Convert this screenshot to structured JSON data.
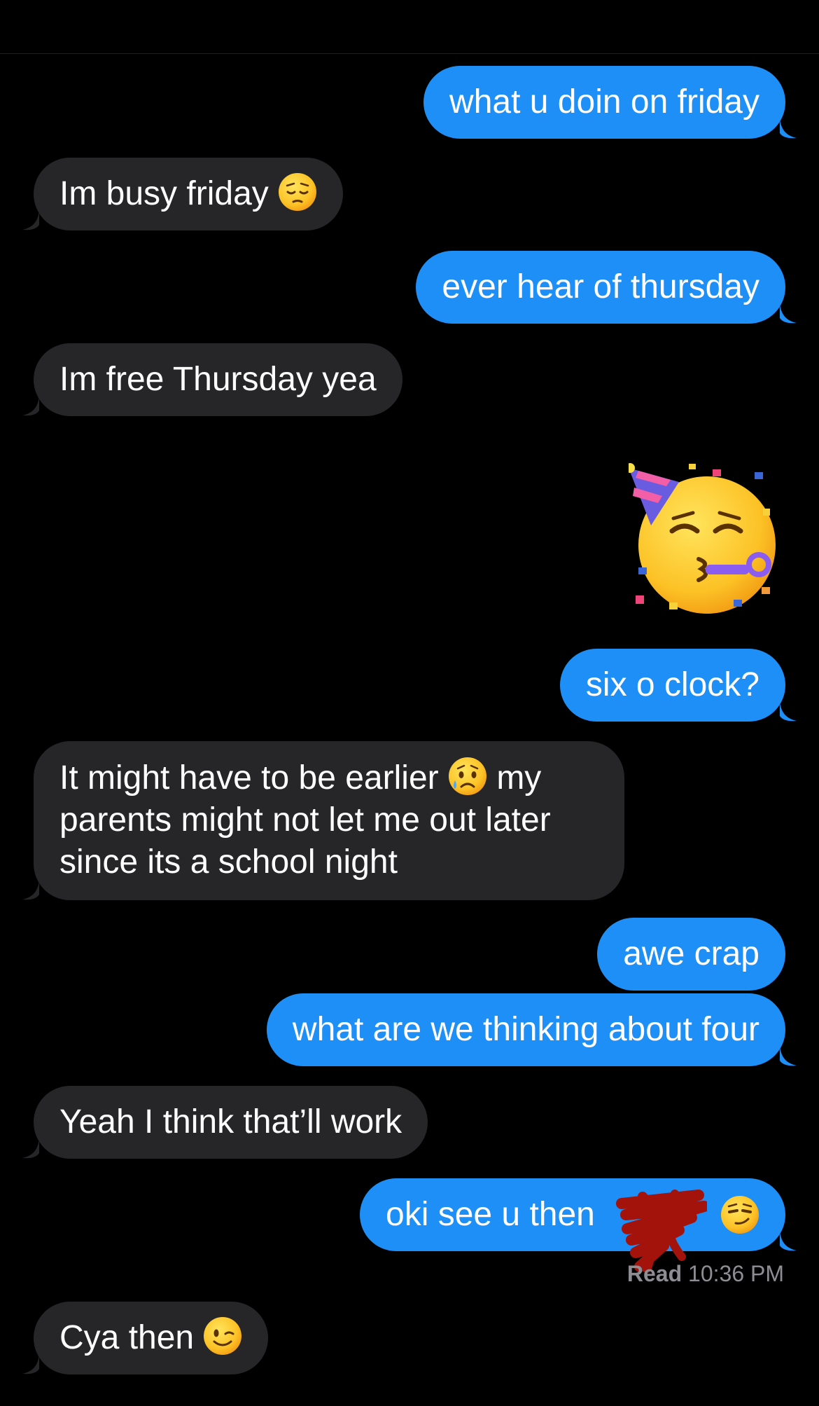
{
  "messages": [
    {
      "from": "me",
      "text": "what u doin on friday"
    },
    {
      "from": "them",
      "text": "Im busy friday",
      "emoji": "pensive-face"
    },
    {
      "from": "me",
      "text": "ever hear of thursday"
    },
    {
      "from": "them",
      "text": "Im free Thursday yea"
    },
    {
      "from": "me",
      "emoji": "partying-face"
    },
    {
      "from": "me",
      "text": "six o clock?"
    },
    {
      "from": "them",
      "text_before": "It might have to be earlier",
      "emoji": "sad-but-relieved-face",
      "text_after": "my parents might not let me out later since its a school night"
    },
    {
      "from": "me",
      "text": "awe crap"
    },
    {
      "from": "me",
      "text": "what are we thinking about four"
    },
    {
      "from": "them",
      "text": "Yeah I think that’ll work"
    },
    {
      "from": "me",
      "text": "oki see u then",
      "redacted": true,
      "emoji": "smirking-face"
    },
    {
      "from": "them",
      "text": "Cya then",
      "emoji": "winking-face"
    }
  ],
  "receipt": {
    "label": "Read",
    "time": "10:36 PM"
  },
  "colors": {
    "background": "#000000",
    "outgoing_bubble": "#1d8ff6",
    "incoming_bubble": "#262629",
    "receipt_text": "#8d8d93",
    "redaction": "#a4120c"
  }
}
